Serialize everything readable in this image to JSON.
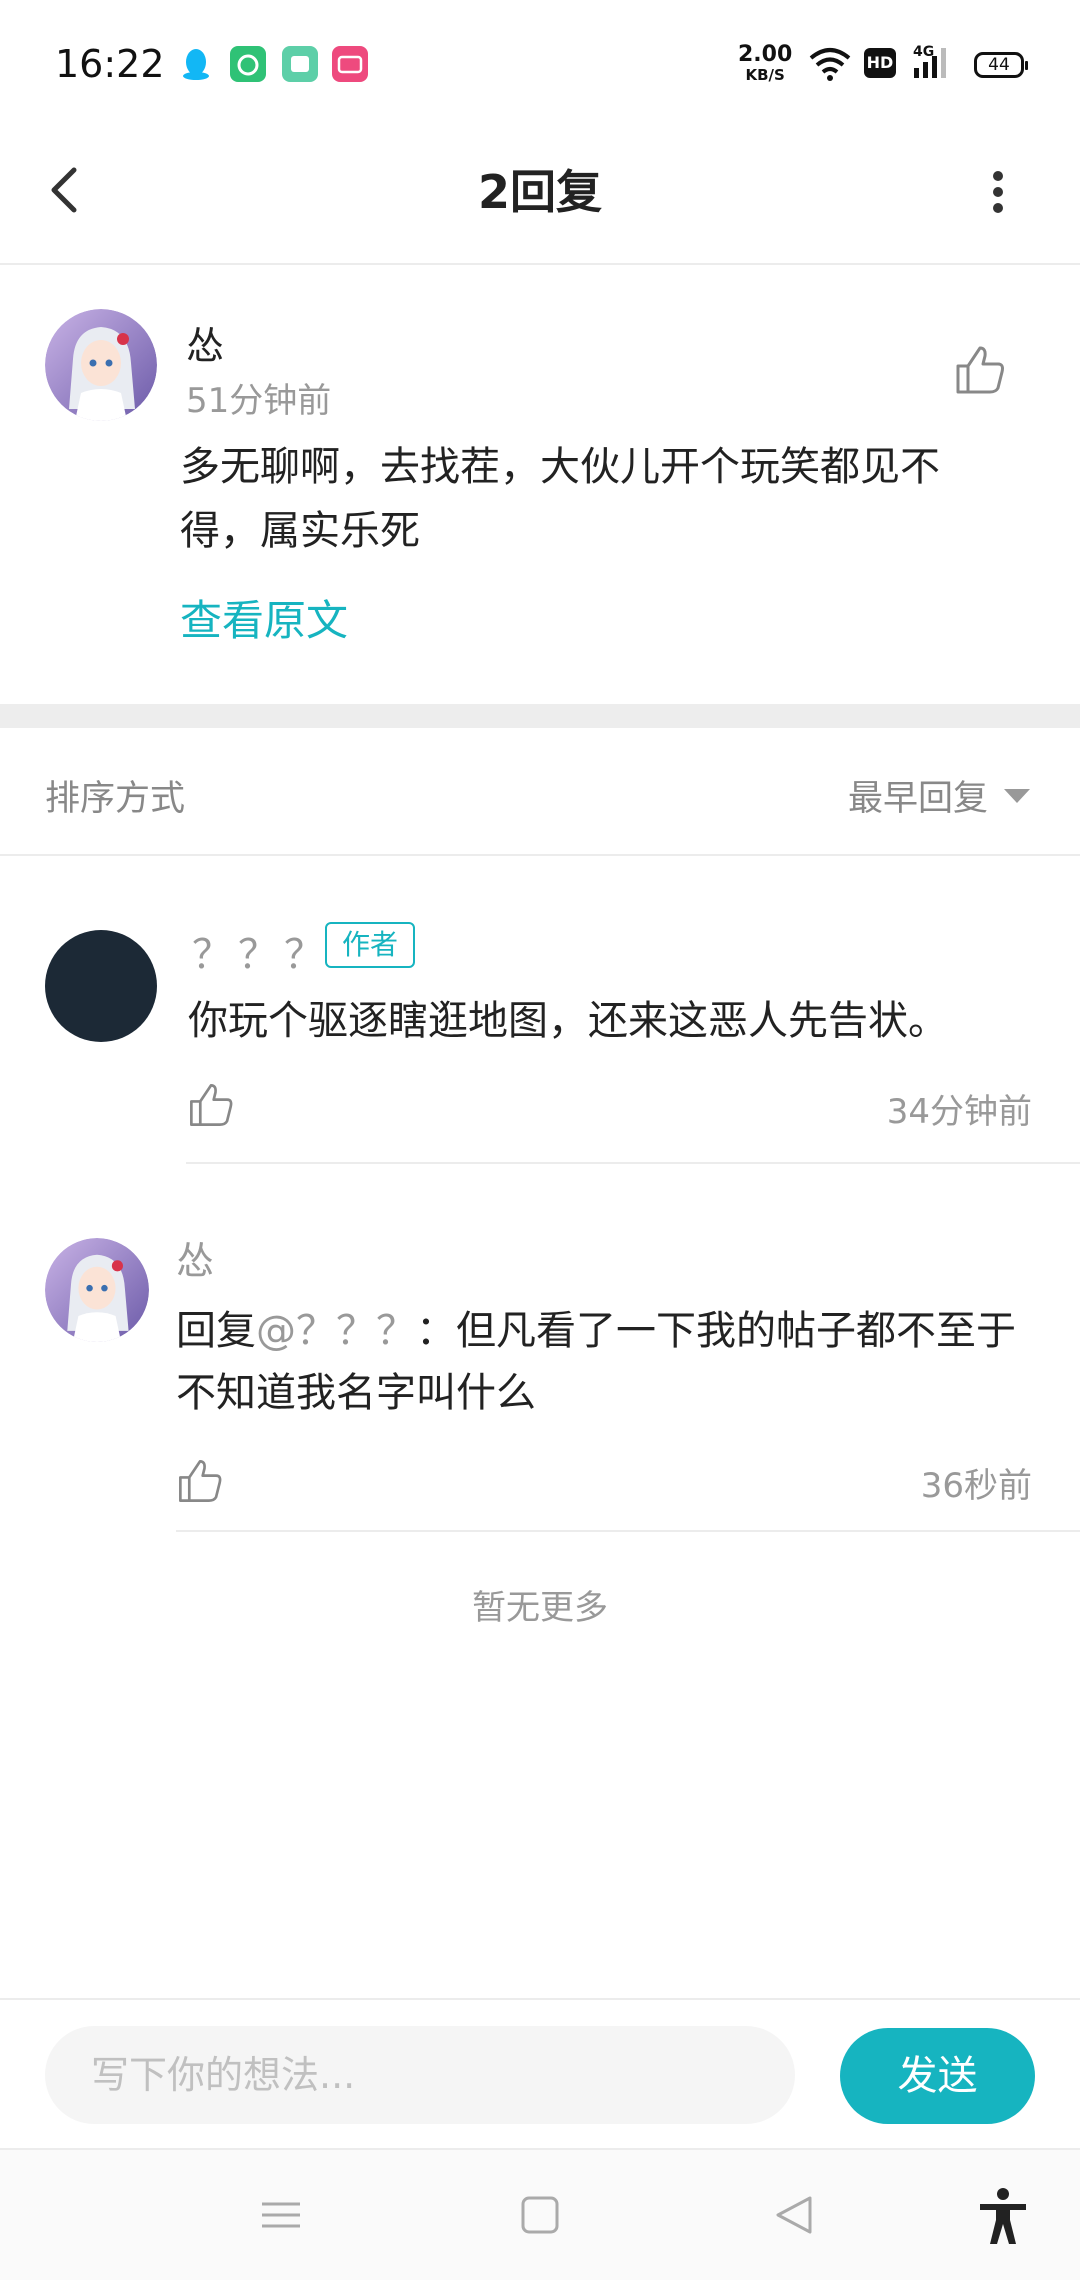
{
  "status_bar": {
    "time": "16:22",
    "net_speed_value": "2.00",
    "net_speed_unit": "KB/S",
    "hd_label": "HD",
    "network_type": "4G",
    "battery": "44"
  },
  "header": {
    "title": "2回复"
  },
  "post": {
    "author": "怂",
    "time": "51分钟前",
    "body": "多无聊啊，去找茬，大伙儿开个玩笑都见不得，属实乐死",
    "view_original": "查看原文"
  },
  "sort": {
    "label": "排序方式",
    "selected": "最早回复"
  },
  "replies": [
    {
      "author": "？？？",
      "badge": "作者",
      "body": "你玩个驱逐瞎逛地图，还来这恶人先告状。",
      "time": "34分钟前"
    },
    {
      "author": "怂",
      "prefix": "回复",
      "mention": "@？？？",
      "body": "：但凡看了一下我的帖子都不至于不知道我名字叫什么",
      "time": "36秒前"
    }
  ],
  "no_more": "暂无更多",
  "input": {
    "placeholder": "写下你的想法...",
    "send_label": "发送"
  },
  "colors": {
    "accent": "#16b4c0"
  }
}
